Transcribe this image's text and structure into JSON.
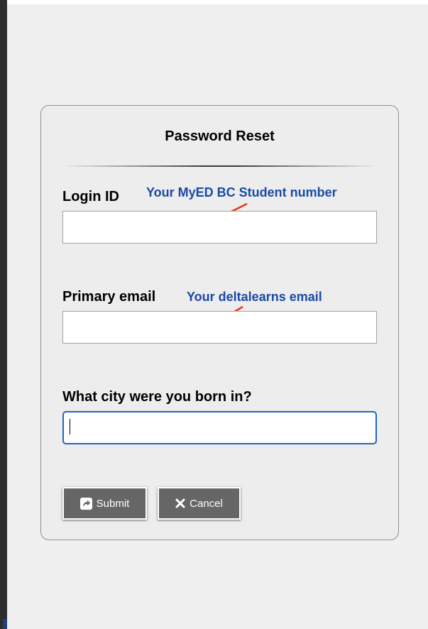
{
  "form": {
    "title": "Password Reset",
    "fields": [
      {
        "label": "Login ID",
        "hint": "Your MyED BC Student number",
        "value": "",
        "placeholder": ""
      },
      {
        "label": "Primary email",
        "hint": "Your deltalearns email",
        "value": "",
        "placeholder": ""
      },
      {
        "label": "What city were you born in?",
        "value": "",
        "placeholder": ""
      }
    ],
    "buttons": {
      "submit_label": "Submit",
      "submit_icon": "share-arrow-icon",
      "cancel_label": "Cancel",
      "cancel_icon": "x-icon"
    }
  },
  "colors": {
    "hint_text": "#1a4aa6",
    "annotation_arrow": "#e8341c",
    "focus_border": "#2465c4",
    "button_bg": "#666666"
  }
}
